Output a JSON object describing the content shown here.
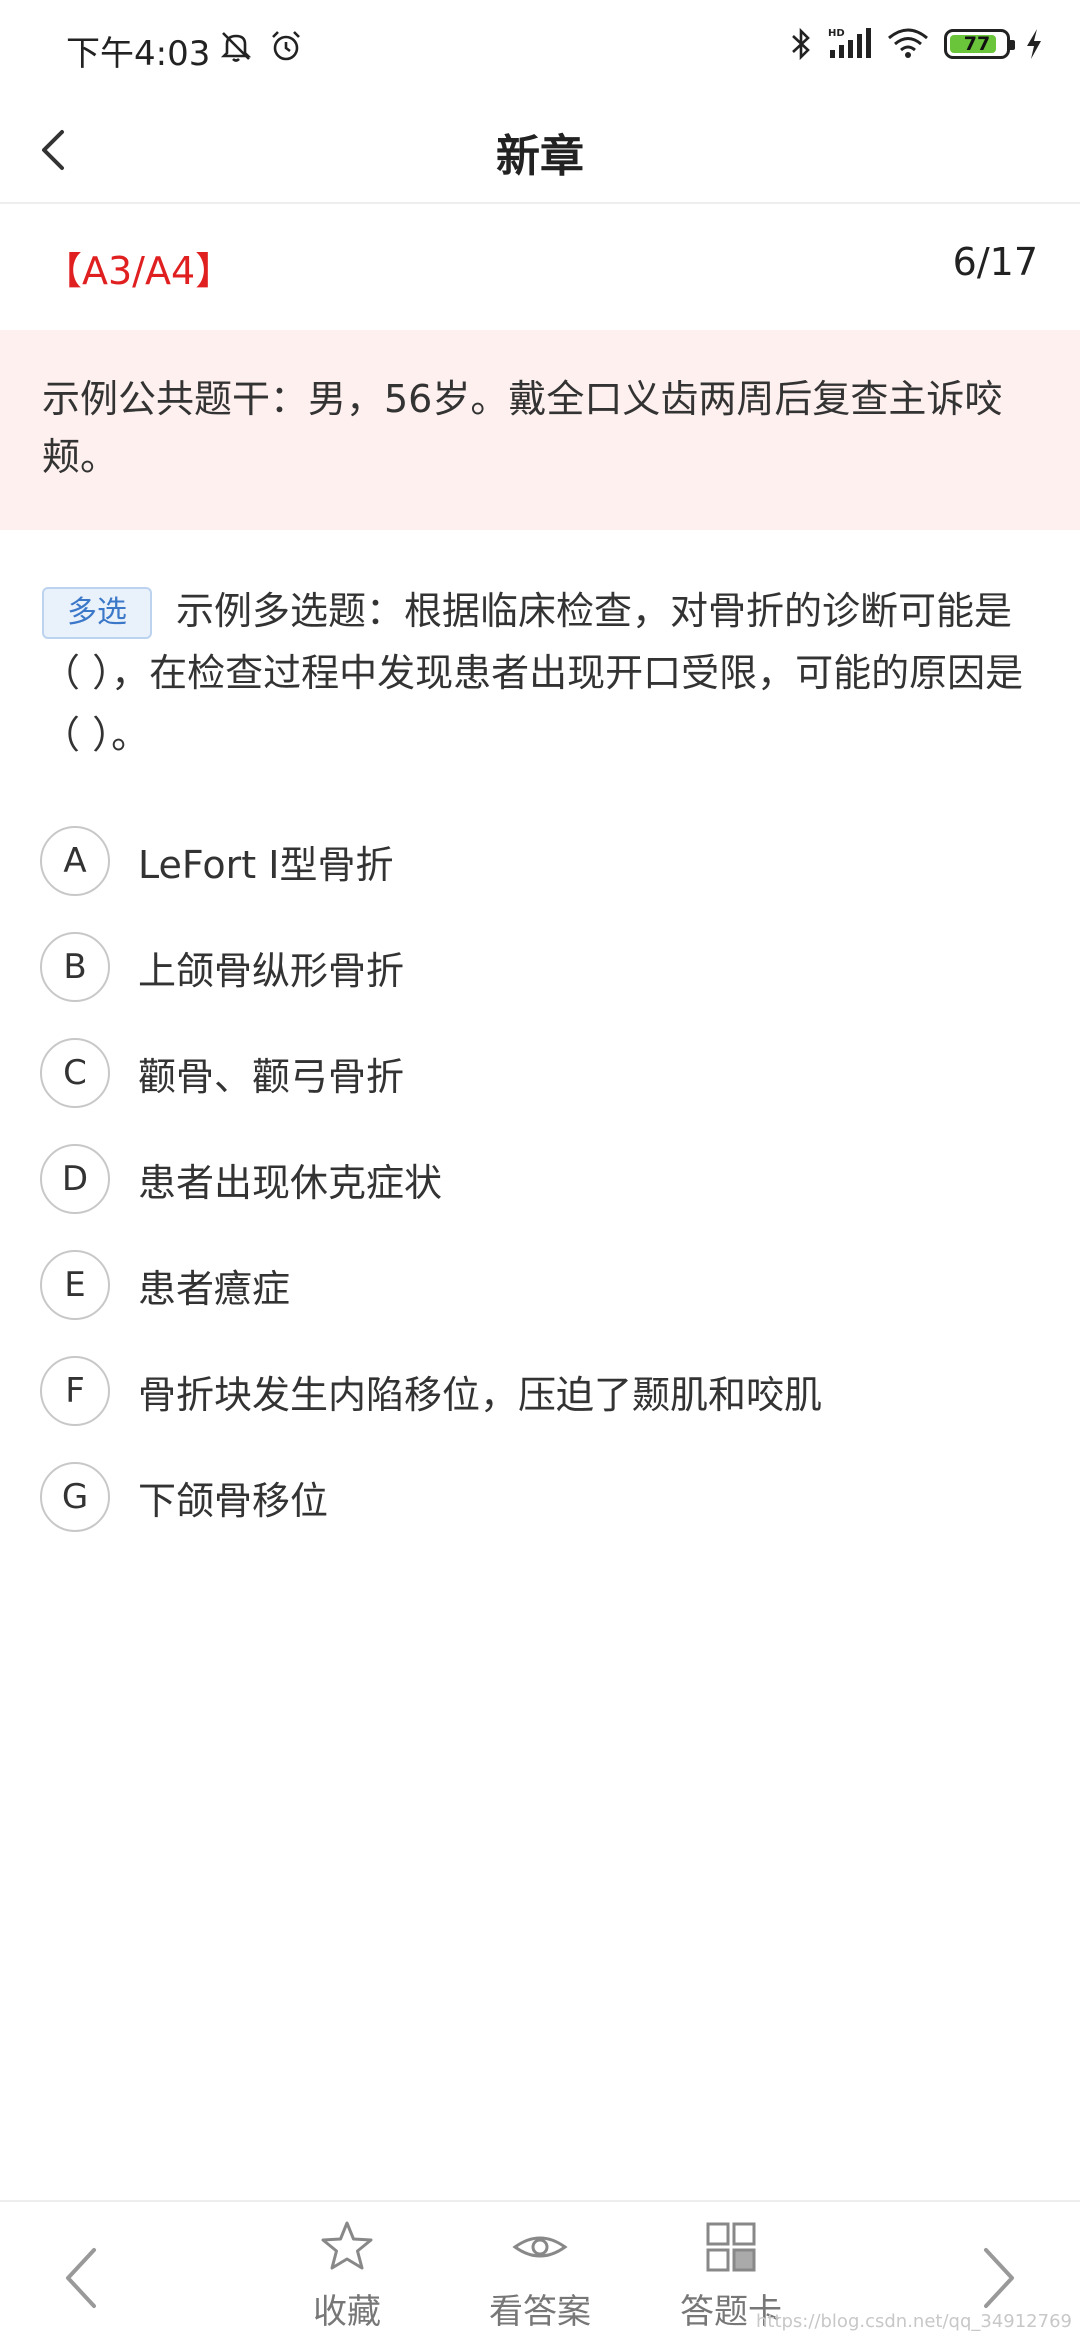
{
  "status_bar": {
    "time": "下午4:03",
    "battery_level": "77",
    "icons": [
      "mute-icon",
      "alarm-icon",
      "bluetooth-icon",
      "signal-hd-icon",
      "wifi-icon",
      "battery-icon",
      "charging-icon"
    ]
  },
  "header": {
    "title": "新章",
    "back_icon": "chevron-left-icon"
  },
  "question_meta": {
    "type": "【A3/A4】",
    "progress": "6/17"
  },
  "stem": "示例公共题干：男，56岁。戴全口义齿两周后复查主诉咬颊。",
  "question": {
    "tag": "多选",
    "text": "示例多选题：根据临床检查，对骨折的诊断可能是（ ），在检查过程中发现患者出现开口受限，可能的原因是（ ）。"
  },
  "options": [
    {
      "letter": "A",
      "text": "LeFort I型骨折"
    },
    {
      "letter": "B",
      "text": "上颌骨纵形骨折"
    },
    {
      "letter": "C",
      "text": "颧骨、颧弓骨折"
    },
    {
      "letter": "D",
      "text": "患者出现休克症状"
    },
    {
      "letter": "E",
      "text": "患者癔症"
    },
    {
      "letter": "F",
      "text": "骨折块发生内陷移位，压迫了颞肌和咬肌"
    },
    {
      "letter": "G",
      "text": "下颌骨移位"
    }
  ],
  "bottom_bar": {
    "favorite_label": "收藏",
    "view_answer_label": "看答案",
    "answer_card_label": "答题卡"
  },
  "watermark": "https://blog.csdn.net/qq_34912769",
  "colors": {
    "accent_red": "#e02020",
    "stem_background": "#fdf0ef",
    "tag_blue": "#3b78c8",
    "battery_green": "#6ac53b"
  }
}
